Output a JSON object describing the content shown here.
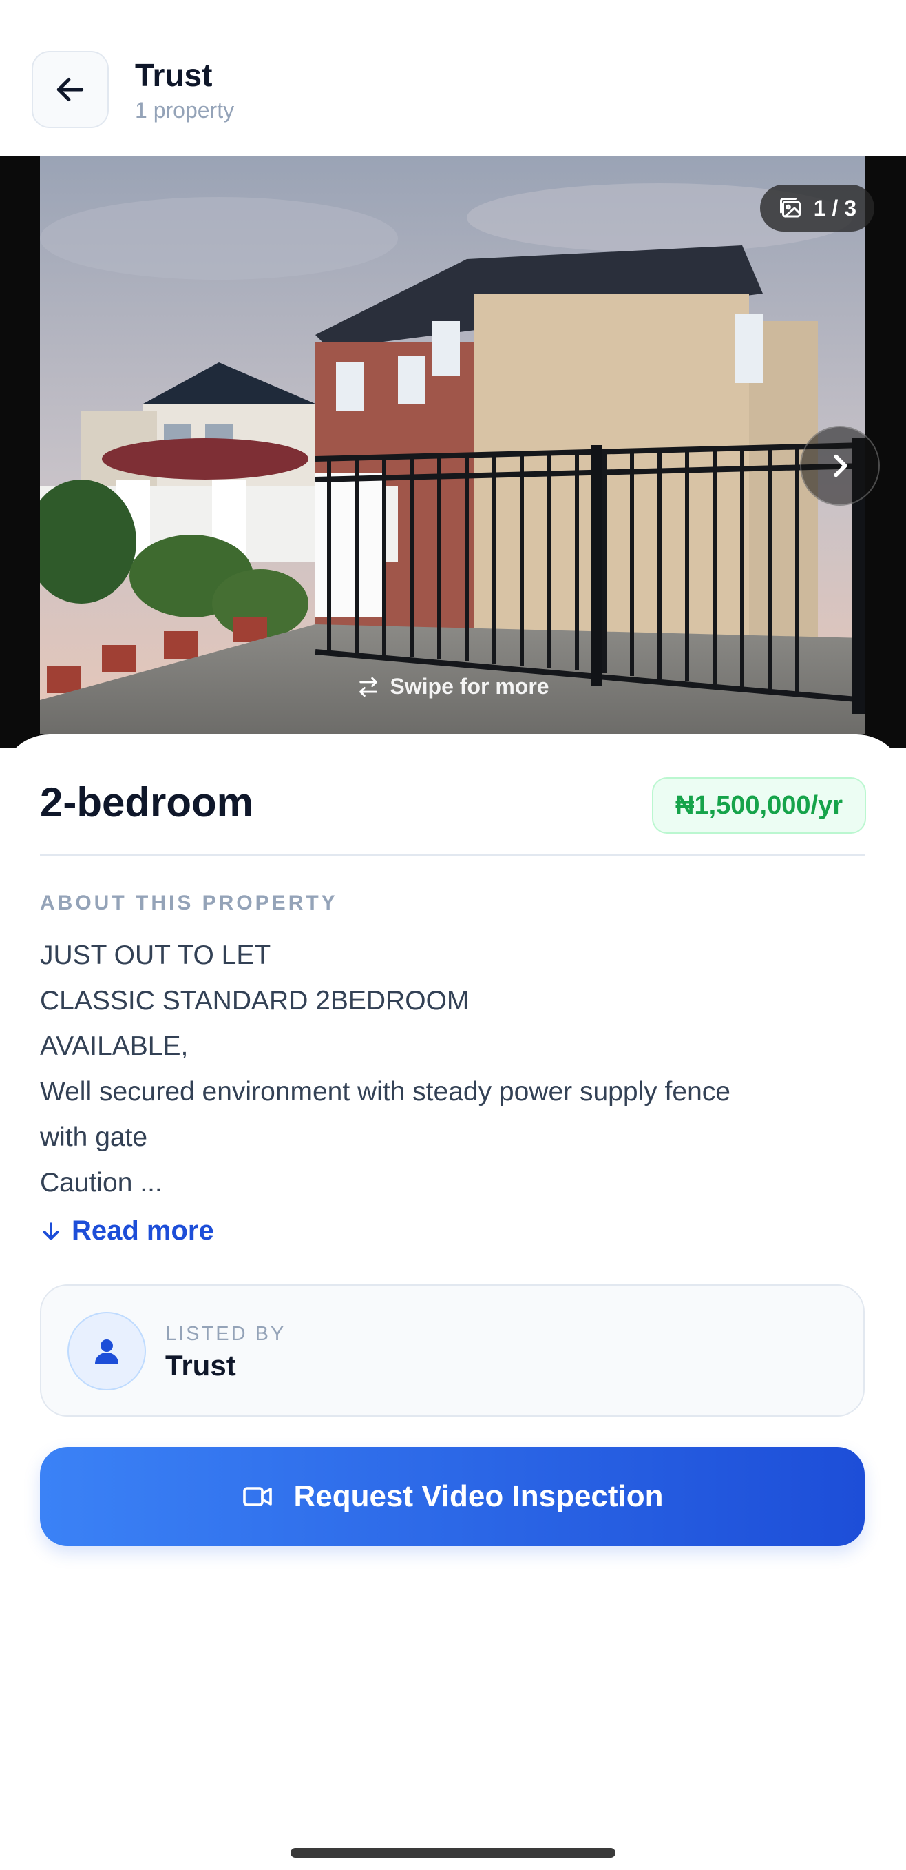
{
  "header": {
    "title": "Trust",
    "subtitle": "1 property"
  },
  "gallery": {
    "counter": "1 / 3",
    "swipe_hint": "Swipe for more"
  },
  "listing": {
    "title": "2-bedroom",
    "price": "₦1,500,000/yr",
    "section_label": "ABOUT THIS PROPERTY",
    "description_lines": [
      "JUST OUT TO LET",
      "CLASSIC STANDARD 2BEDROOM",
      "AVAILABLE,",
      "Well secured environment with steady power supply fence",
      "with gate",
      "Caution ..."
    ],
    "read_more": "Read more"
  },
  "lister": {
    "label": "LISTED BY",
    "name": "Trust"
  },
  "cta": {
    "label": "Request Video Inspection"
  },
  "colors": {
    "accent": "#2563eb",
    "price_text": "#16a34a",
    "price_bg": "#ecfdf3"
  },
  "icons": {
    "back": "arrow-left-icon",
    "gallery": "image-icon",
    "next": "chevron-right-icon",
    "swipe": "swap-arrows-icon",
    "read_more": "arrow-down-icon",
    "avatar": "user-icon",
    "cta": "video-camera-icon"
  }
}
